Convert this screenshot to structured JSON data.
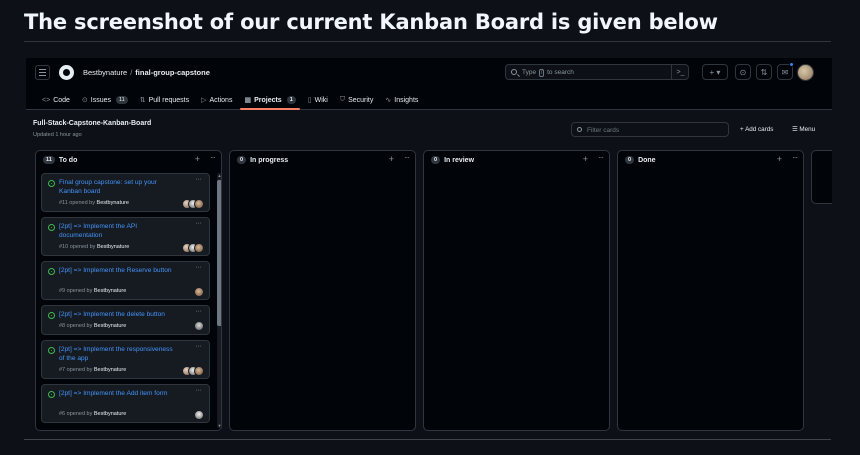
{
  "heading": "The screenshot of our current Kanban Board is given below",
  "header": {
    "owner": "Bestbynature",
    "separator": "/",
    "repo": "final-group-capstone",
    "search_placeholder_pre": "Type",
    "search_key": "/",
    "search_placeholder_post": "to search",
    "command_icon": ">_",
    "plus_label": "+ ▾",
    "issues_icon": "⊙",
    "pulls_icon": "⇅",
    "inbox_icon": "✉",
    "accent": "#2f81f7"
  },
  "tabs": [
    {
      "icon": "<>",
      "label": "Code",
      "count": ""
    },
    {
      "icon": "⊙",
      "label": "Issues",
      "count": "11"
    },
    {
      "icon": "⇅",
      "label": "Pull requests",
      "count": ""
    },
    {
      "icon": "▷",
      "label": "Actions",
      "count": ""
    },
    {
      "icon": "▦",
      "label": "Projects",
      "count": "1"
    },
    {
      "icon": "▯",
      "label": "Wiki",
      "count": ""
    },
    {
      "icon": "⛉",
      "label": "Security",
      "count": ""
    },
    {
      "icon": "∿",
      "label": "Insights",
      "count": ""
    }
  ],
  "project": {
    "title": "Full-Stack-Capstone-Kanban-Board",
    "updated": "Updated 1 hour ago",
    "filter_placeholder": "Filter cards",
    "add_cards": "+ Add cards",
    "menu": "☰ Menu"
  },
  "columns": [
    {
      "count": "11",
      "name": "To do"
    },
    {
      "count": "0",
      "name": "In progress"
    },
    {
      "count": "0",
      "name": "In review"
    },
    {
      "count": "0",
      "name": "Done"
    }
  ],
  "cards": [
    {
      "title": "Final group capstone: set up your Kanban board",
      "number": "#11 opened by",
      "author": "Bestbynature"
    },
    {
      "title": "[2pt] => Implement the API documentation",
      "number": "#10 opened by",
      "author": "Bestbynature"
    },
    {
      "title": "[2pt] => Implement the Reserve button",
      "number": "#9 opened by",
      "author": "Bestbynature"
    },
    {
      "title": "[2pt] => Implement the delete button",
      "number": "#8 opened by",
      "author": "Bestbynature"
    },
    {
      "title": "[2pt] => Implement the responsiveness of the app",
      "number": "#7 opened by",
      "author": "Bestbynature"
    },
    {
      "title": "[2pt] => Implement the Add item form",
      "number": "#6 opened by",
      "author": "Bestbynature"
    }
  ],
  "colors": {
    "status_open": "#3fb950",
    "link": "#4493f8",
    "active_tab_underline": "#f78166",
    "background": "#0d1117"
  }
}
